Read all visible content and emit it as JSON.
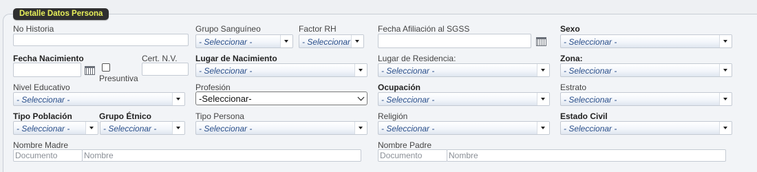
{
  "panel": {
    "legend": "Detalle Datos Persona"
  },
  "placeholder_select": "- Seleccionar -",
  "fields": {
    "no_historia": "No Historia",
    "grupo_sanguineo": "Grupo Sanguíneo",
    "factor_rh": "Factor RH",
    "factor_rh_value": "- Seleccionar -",
    "fecha_afiliacion": "Fecha Afiliación al SGSS",
    "sexo": "Sexo",
    "fecha_nacimiento": "Fecha Nacimiento",
    "presuntiva": "Presuntiva",
    "cert_nv": "Cert. N.V.",
    "lugar_nacimiento": "Lugar de Nacimiento",
    "lugar_residencia": "Lugar de Residencia:",
    "zona": "Zona:",
    "nivel_educativo": "Nivel Educativo",
    "profesion": "Profesión",
    "profesion_value": "-Seleccionar-",
    "ocupacion": "Ocupación",
    "estrato": "Estrato",
    "tipo_poblacion": "Tipo Población",
    "grupo_etnico": "Grupo Étnico",
    "tipo_persona": "Tipo Persona",
    "religion": "Religión",
    "estado_civil": "Estado Civil",
    "nombre_madre": "Nombre Madre",
    "nombre_padre": "Nombre Padre"
  },
  "inputs": {
    "documento_placeholder": "Documento",
    "nombre_placeholder": "Nombre"
  },
  "icons": {
    "calendar": "calendar-icon",
    "dropdown": "triangle-down-icon"
  },
  "colors": {
    "legend_bg": "#2f2f2f",
    "legend_text": "#e8f05a",
    "select_text": "#2a4f8a"
  }
}
